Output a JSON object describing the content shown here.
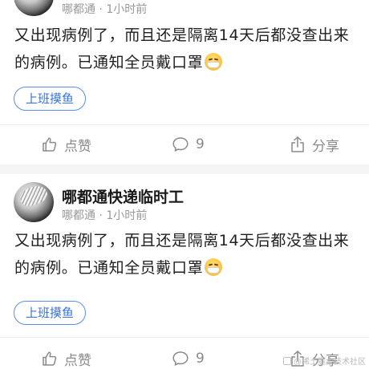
{
  "posts": [
    {
      "author_name": "",
      "author_meta": "哪都通 · 1小时前",
      "content_lines": [
        "又出现病例了，而且还是隔离14天后都没查出来",
        "的病例。已通知全员戴口罩"
      ],
      "emoji": "mask-face-emoji",
      "tag": "上班摸鱼",
      "like_label": "点赞",
      "comment_count": "9",
      "share_label": "分享"
    },
    {
      "author_name": "哪都通快递临时工",
      "author_meta": "哪都通 · 1小时前",
      "content_lines": [
        "又出现病例了，而且还是隔离14天后都没查出来",
        "的病例。已通知全员戴口罩"
      ],
      "emoji": "mask-face-emoji",
      "tag": "上班摸鱼",
      "like_label": "点赞",
      "comment_count": "9",
      "share_label": "分享"
    }
  ],
  "watermark": "@稀土掘金技术社区",
  "icons": {
    "like": "thumbs-up-icon",
    "comment": "comment-bubble-icon",
    "share": "share-icon"
  },
  "colors": {
    "tag_border": "#5a8de6",
    "tag_text": "#3b74d9",
    "action_text": "#8a8a8a",
    "meta_text": "#999999",
    "divider_band": "#f4f5f7"
  }
}
